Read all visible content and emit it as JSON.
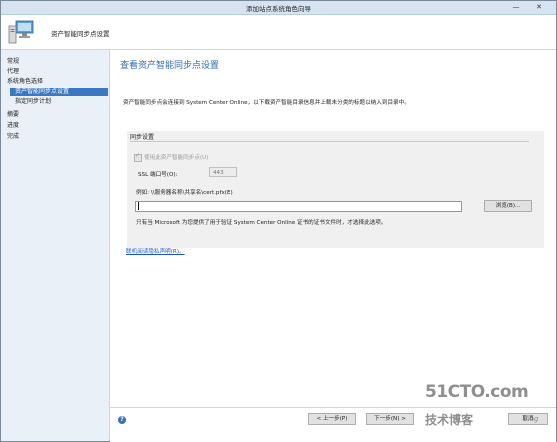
{
  "window": {
    "title": "添加站点系统角色向导",
    "minimize_glyph": "—",
    "close_glyph": "✕"
  },
  "header": {
    "icon": "computer-wizard-icon",
    "text": "资产智能同步点设置"
  },
  "nav": {
    "items": [
      {
        "label": "常规"
      },
      {
        "label": "代理"
      },
      {
        "label": "系统角色选择"
      },
      {
        "label": "资产智能同步点设置"
      },
      {
        "label": "指定同步计划"
      },
      {
        "label": "摘要"
      },
      {
        "label": "进度"
      },
      {
        "label": "完成"
      }
    ],
    "active_index": 3
  },
  "main": {
    "title": "查看资产智能同步点设置",
    "description": "资产智能同步点会连接到 System Center Online，以下载资产智能目录信息并上载未分类的标题以纳入到目录中。",
    "group": {
      "title": "同步设置",
      "checkbox_label": "使用此资产智能同步点(U)",
      "checkbox_checked": true,
      "checkbox_enabled": false,
      "ssl_label": "SSL 端口号(O):",
      "ssl_value": "443",
      "example_label": "例如: \\\\服务器名称\\共享名\\cert.pfx(E)",
      "path_value": "",
      "browse_label": "浏览(B)...",
      "hint": "只有当 Microsoft 为您提供了用于验证 System Center Online 证书的证书文件时，才选择此选项。"
    },
    "privacy_link": "联机阅读隐私声明(R)。"
  },
  "footer": {
    "help_glyph": "?",
    "prev_label": "< 上一步(P)",
    "next_label": "下一步(N) >",
    "cancel_label": "取消"
  },
  "watermark": {
    "line1": "51CTO.com",
    "line2": "技术博客",
    "line3": "Blog"
  }
}
